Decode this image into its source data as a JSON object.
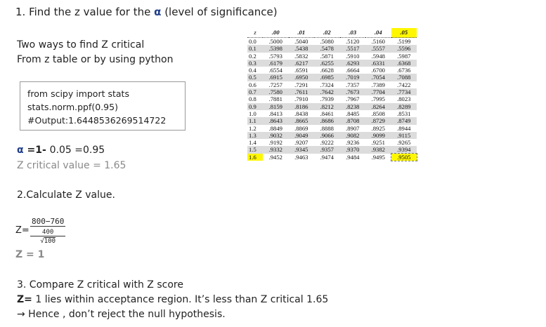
{
  "heading1": {
    "prefix": "1. Find the z value for the ",
    "alpha": "α",
    "suffix": " (level of significance)"
  },
  "two_ways": {
    "line1": "Two ways to find Z critical",
    "line2": "From z table or by using python"
  },
  "code": {
    "line1": "from scipy import stats",
    "line2": "stats.norm.ppf(0.95)",
    "line3": "#Output:1.6448536269514722"
  },
  "alpha_eq": {
    "alpha": "α",
    "part1": " =1- ",
    "part2": "0.05 =0.95"
  },
  "z_critical": "Z critical value = 1.65",
  "heading2": "2.Calculate Z  value.",
  "z_formula": {
    "lhs": "Z=",
    "numerator": "800−760",
    "denom_top": "400",
    "denom_bottom": "100",
    "sqrt": "√"
  },
  "z_result": "Z = 1",
  "heading3": "3. Compare Z critical with Z score",
  "compare": {
    "bold": "Z=",
    "text": " 1 lies within acceptance region.  It’s less than Z critical 1.65"
  },
  "conclusion": "→ Hence , don’t reject the null hypothesis.",
  "z_table": {
    "corner": "z",
    "columns": [
      ".00",
      ".01",
      ".02",
      ".03",
      ".04",
      ".05"
    ],
    "highlight_color": "#fff700",
    "rows": [
      {
        "z": "0.0",
        "v": [
          ".5000",
          ".5040",
          ".5080",
          ".5120",
          ".5160",
          ".5199"
        ]
      },
      {
        "z": "0.1",
        "v": [
          ".5398",
          ".5438",
          ".5478",
          ".5517",
          ".5557",
          ".5596"
        ]
      },
      {
        "z": "0.2",
        "v": [
          ".5793",
          ".5832",
          ".5871",
          ".5910",
          ".5948",
          ".5987"
        ]
      },
      {
        "z": "0.3",
        "v": [
          ".6179",
          ".6217",
          ".6255",
          ".6293",
          ".6331",
          ".6368"
        ]
      },
      {
        "z": "0.4",
        "v": [
          ".6554",
          ".6591",
          ".6628",
          ".6664",
          ".6700",
          ".6736"
        ]
      },
      {
        "z": "0.5",
        "v": [
          ".6915",
          ".6950",
          ".6985",
          ".7019",
          ".7054",
          ".7088"
        ]
      },
      {
        "z": "0.6",
        "v": [
          ".7257",
          ".7291",
          ".7324",
          ".7357",
          ".7389",
          ".7422"
        ]
      },
      {
        "z": "0.7",
        "v": [
          ".7580",
          ".7611",
          ".7642",
          ".7673",
          ".7704",
          ".7734"
        ]
      },
      {
        "z": "0.8",
        "v": [
          ".7881",
          ".7910",
          ".7939",
          ".7967",
          ".7995",
          ".8023"
        ]
      },
      {
        "z": "0.9",
        "v": [
          ".8159",
          ".8186",
          ".8212",
          ".8238",
          ".8264",
          ".8289"
        ]
      },
      {
        "z": "1.0",
        "v": [
          ".8413",
          ".8438",
          ".8461",
          ".8485",
          ".8508",
          ".8531"
        ]
      },
      {
        "z": "1.1",
        "v": [
          ".8643",
          ".8665",
          ".8686",
          ".8708",
          ".8729",
          ".8749"
        ]
      },
      {
        "z": "1.2",
        "v": [
          ".8849",
          ".8869",
          ".8888",
          ".8907",
          ".8925",
          ".8944"
        ]
      },
      {
        "z": "1.3",
        "v": [
          ".9032",
          ".9049",
          ".9066",
          ".9082",
          ".9099",
          ".9115"
        ]
      },
      {
        "z": "1.4",
        "v": [
          ".9192",
          ".9207",
          ".9222",
          ".9236",
          ".9251",
          ".9265"
        ]
      },
      {
        "z": "1.5",
        "v": [
          ".9332",
          ".9345",
          ".9357",
          ".9370",
          ".9382",
          ".9394"
        ]
      },
      {
        "z": "1.6",
        "v": [
          ".9452",
          ".9463",
          ".9474",
          ".9484",
          ".9495",
          ".9505"
        ]
      }
    ]
  }
}
